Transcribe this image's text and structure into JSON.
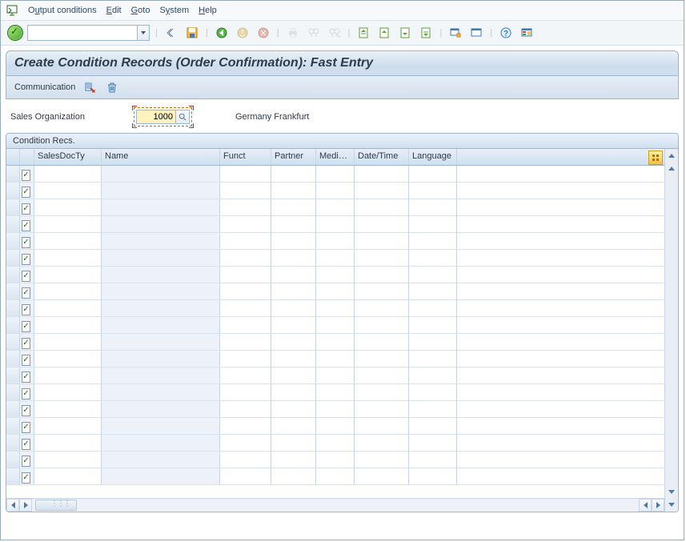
{
  "menu": {
    "items": [
      {
        "pre": "O",
        "u": "u",
        "post": "tput conditions"
      },
      {
        "pre": "",
        "u": "E",
        "post": "dit"
      },
      {
        "pre": "",
        "u": "G",
        "post": "oto"
      },
      {
        "pre": "S",
        "u": "y",
        "post": "stem"
      },
      {
        "pre": "",
        "u": "H",
        "post": "elp"
      }
    ]
  },
  "toolbar": {
    "command_value": ""
  },
  "page_title": "Create Condition Records (Order Confirmation): Fast Entry",
  "app_toolbar": {
    "communication_label": "Communication"
  },
  "selection": {
    "label": "Sales Organization",
    "value": "1000",
    "description": "Germany Frankfurt"
  },
  "table": {
    "title": "Condition Recs.",
    "columns": [
      "SalesDocTy",
      "Name",
      "Funct",
      "Partner",
      "Medium",
      "Date/Time",
      "Language"
    ],
    "row_count": 19
  }
}
